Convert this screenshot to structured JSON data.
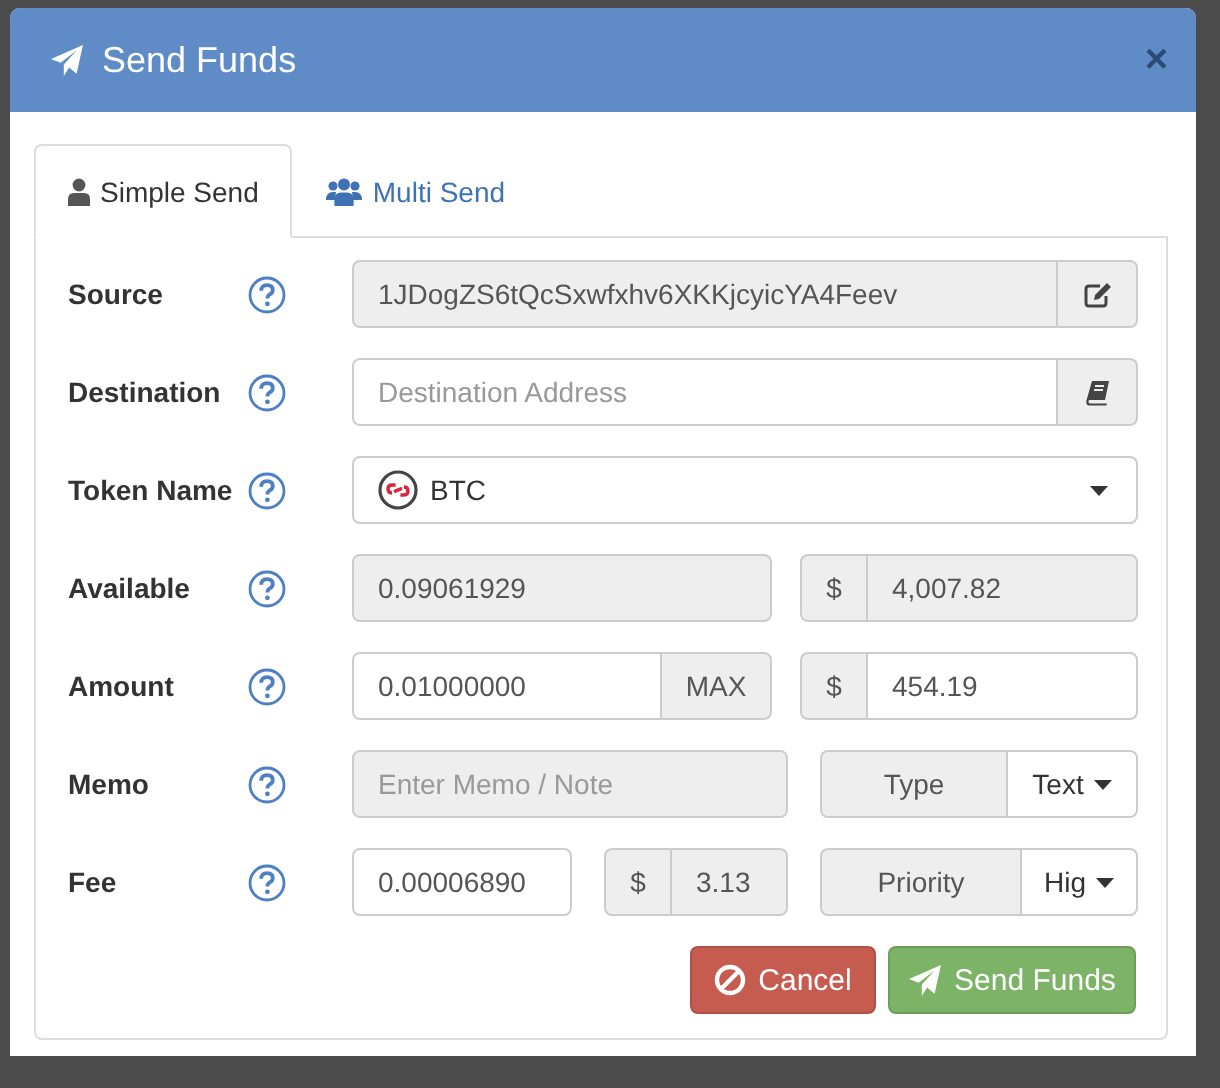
{
  "dialog": {
    "title": "Send Funds",
    "close": "×"
  },
  "tabs": [
    {
      "label": "Simple Send",
      "selected": true
    },
    {
      "label": "Multi Send",
      "selected": false
    }
  ],
  "rows": [
    {
      "kind": "source",
      "label": "Source",
      "value": "1JDogZS6tQcSxwfxhv6XKKjcyicYA4Feev",
      "disabled": true
    },
    {
      "kind": "destination",
      "label": "Destination",
      "placeholder": "Destination Address",
      "disabled": false
    },
    {
      "kind": "select",
      "label": "Token Name",
      "value": "BTC"
    },
    {
      "kind": "amount",
      "label": "Available",
      "value": "0.09061929",
      "disabled": true,
      "currency": "$",
      "usd": "4,007.82"
    },
    {
      "kind": "amount",
      "label": "Amount",
      "value": "0.01000000",
      "disabled": false,
      "addon": "MAX",
      "currency": "$",
      "usd": "454.19"
    },
    {
      "kind": "memo",
      "label": "Memo",
      "placeholder": "Enter Memo / Note",
      "disabled": true,
      "option_label": "Type",
      "option_value": "Text"
    },
    {
      "kind": "fee",
      "label": "Fee",
      "value": "0.00006890",
      "currency": "$",
      "usd": "3.13",
      "option_label": "Priority",
      "option_value": "Hig"
    }
  ],
  "buttons": [
    {
      "label": "Cancel",
      "kind": "cancel"
    },
    {
      "label": "Send Funds",
      "kind": "send"
    }
  ]
}
